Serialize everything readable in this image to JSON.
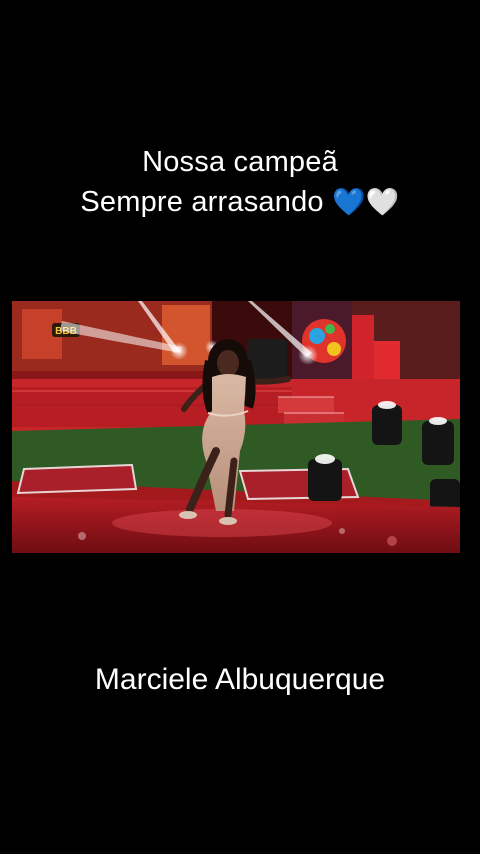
{
  "captions": {
    "line1": "Nossa campeã",
    "line2_text": "Sempre arrasando ",
    "heart_blue": "💙",
    "heart_white": "🤍",
    "bottom": "Marciele Albuquerque"
  },
  "video": {
    "stage_sign": "BBB"
  },
  "colors": {
    "background": "#000000",
    "caption_text": "#ffffff",
    "stage_red": "#c81e24",
    "floor_green": "#2f5a23"
  }
}
